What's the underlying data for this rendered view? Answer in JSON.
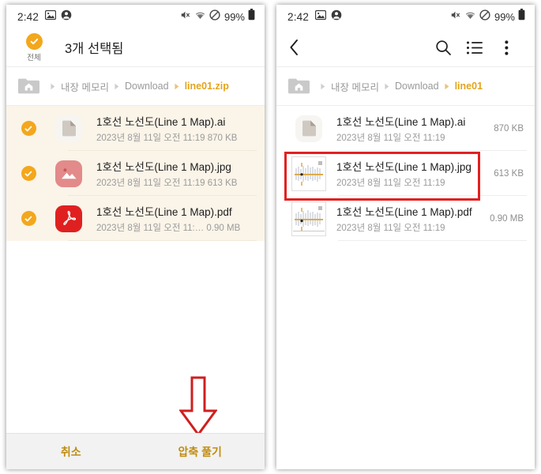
{
  "status_bar": {
    "time": "2:42",
    "left_icons": [
      "image-icon",
      "account-icon"
    ],
    "right_icons": [
      "mute-icon",
      "wifi-icon",
      "do-not-disturb-icon"
    ],
    "battery_text": "99%",
    "battery_icon": "battery-icon"
  },
  "left_panel": {
    "action_bar": {
      "select_all_label": "전체",
      "select_all_icon": "check-circle-icon",
      "title": "3개 선택됨"
    },
    "breadcrumb": {
      "home_icon": "home-folder-icon",
      "items": [
        {
          "label": "내장 메모리",
          "active": false
        },
        {
          "label": "Download",
          "active": false
        },
        {
          "label": "line01.zip",
          "active": true
        }
      ]
    },
    "files": [
      {
        "name": "1호선 노선도(Line 1 Map).ai",
        "meta": "2023년 8월 11일 오전 11:19 870 KB",
        "icon": "generic-document-icon",
        "checked": true
      },
      {
        "name": "1호선 노선도(Line 1 Map).jpg",
        "meta": "2023년 8월 11일 오전 11:19 613 KB",
        "icon": "image-file-icon",
        "checked": true
      },
      {
        "name": "1호선 노선도(Line 1 Map).pdf",
        "meta": "2023년 8월 11일 오전 11:… 0.90 MB",
        "icon": "pdf-file-icon",
        "checked": true
      }
    ],
    "bottom_bar": {
      "cancel_label": "취소",
      "extract_label": "압축 풀기"
    },
    "annotation": {
      "arrow": "red-down-arrow",
      "color": "#e32020"
    }
  },
  "right_panel": {
    "toolbar": {
      "back_icon": "back-chevron-icon",
      "search_icon": "search-icon",
      "list_view_icon": "list-view-icon",
      "more_icon": "more-vertical-icon"
    },
    "breadcrumb": {
      "home_icon": "home-folder-icon",
      "items": [
        {
          "label": "내장 메모리",
          "active": false
        },
        {
          "label": "Download",
          "active": false
        },
        {
          "label": "line01",
          "active": true
        }
      ]
    },
    "files": [
      {
        "name": "1호선 노선도(Line 1 Map).ai",
        "meta": "2023년 8월 11일 오전 11:19",
        "size": "870 KB",
        "icon": "generic-document-icon",
        "highlighted": false
      },
      {
        "name": "1호선 노선도(Line 1 Map).jpg",
        "meta": "2023년 8월 11일 오전 11:19",
        "size": "613 KB",
        "icon": "subway-map-thumbnail",
        "highlighted": true
      },
      {
        "name": "1호선 노선도(Line 1 Map).pdf",
        "meta": "2023년 8월 11일 오전 11:19",
        "size": "0.90 MB",
        "icon": "subway-map-thumbnail",
        "highlighted": false
      }
    ],
    "annotation": {
      "box": "red-highlight-box",
      "color": "#e32020"
    }
  },
  "colors": {
    "accent_orange": "#f3a71c",
    "breadcrumb_active": "#e3a41b",
    "annotation_red": "#e32020",
    "selected_row_bg": "#fbf4e9",
    "bottom_bar_bg": "#f2f2f2",
    "button_text": "#c08d12"
  }
}
